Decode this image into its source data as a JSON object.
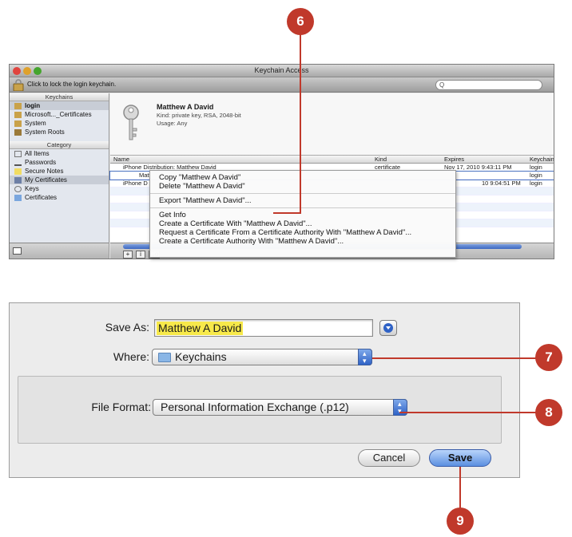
{
  "callouts": {
    "c6": "6",
    "c7": "7",
    "c8": "8",
    "c9": "9"
  },
  "keychain_window": {
    "title": "Keychain Access",
    "lock_text": "Click to lock the login keychain.",
    "search_placeholder": "Q",
    "keychains_header": "Keychains",
    "keychains": [
      "login",
      "Microsoft..._Certificates",
      "System",
      "System Roots"
    ],
    "category_header": "Category",
    "categories": [
      "All Items",
      "Passwords",
      "Secure Notes",
      "My Certificates",
      "Keys",
      "Certificates"
    ],
    "info": {
      "name": "Matthew A David",
      "kind": "Kind:  private key, RSA, 2048-bit",
      "usage": "Usage:  Any"
    },
    "table": {
      "headers": {
        "name": "Name",
        "kind": "Kind",
        "expires": "Expires",
        "keychain": "Keychain"
      },
      "rows": [
        {
          "name": "iPhone Distribution: Matthew David",
          "kind": "certificate",
          "expires": "Nov 17, 2010 9:43:11 PM",
          "keychain": "login"
        },
        {
          "name": "Matt",
          "kind": "",
          "expires": "",
          "keychain": "login"
        },
        {
          "name": "iPhone D",
          "kind": "",
          "expires": "10 9:04:51 PM",
          "keychain": "login"
        }
      ]
    },
    "bottom_buttons": {
      "add": "+",
      "info": "i",
      "copy": "Co"
    }
  },
  "context_menu": {
    "group1": [
      "Copy \"Matthew A David\"",
      "Delete \"Matthew A David\""
    ],
    "group2": [
      "Export \"Matthew A David\"..."
    ],
    "group3": [
      "Get Info",
      "Create a Certificate With \"Matthew A David\"...",
      "Request a Certificate From a Certificate Authority With \"Matthew A David\"...",
      "Create a Certificate Authority With \"Matthew A David\"..."
    ]
  },
  "save_dialog": {
    "save_as_label": "Save As:",
    "save_as_value": "Matthew A David",
    "where_label": "Where:",
    "where_value": "Keychains",
    "file_format_label": "File Format:",
    "file_format_value": "Personal Information Exchange (.p12)",
    "cancel_label": "Cancel",
    "save_label": "Save"
  },
  "colors": {
    "callout": "#c0392b",
    "highlight": "#f7e94a",
    "accent": "#3d68c2"
  }
}
